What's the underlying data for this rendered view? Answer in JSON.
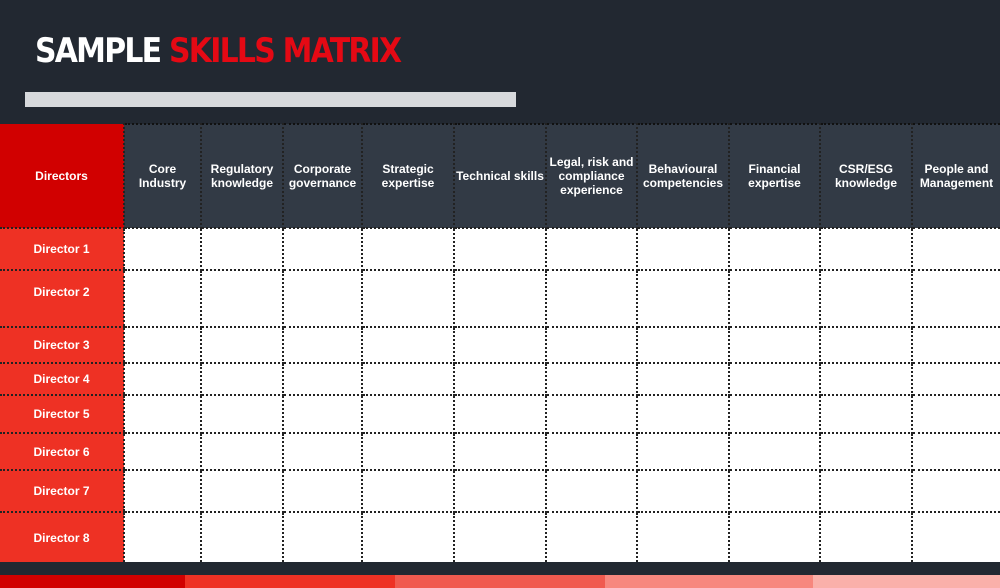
{
  "title": {
    "word1": "SAMPLE",
    "word2": "SKILLS MATRIX"
  },
  "colors": {
    "background": "#222831",
    "header_cell": "#323a45",
    "corner_cell": "#d10000",
    "row_header": "#ee3124",
    "accent_red": "#e50914"
  },
  "table": {
    "corner_label": "Directors",
    "columns": [
      "Core Industry",
      "Regulatory knowledge",
      "Corporate governance",
      "Strategic expertise",
      "Technical skills",
      "Legal, risk and compliance experience",
      "Behavioural competencies",
      "Financial expertise",
      "CSR/ESG knowledge",
      "People and Management"
    ],
    "rows": [
      "Director 1",
      "Director 2",
      "Director 3",
      "Director 4",
      "Director 5",
      "Director 6",
      "Director 7",
      "Director 8"
    ]
  },
  "footer": {
    "strip_colors": [
      "#d10000",
      "#ee3124",
      "#f05a4f",
      "#f7877e",
      "#fab0aa"
    ]
  }
}
